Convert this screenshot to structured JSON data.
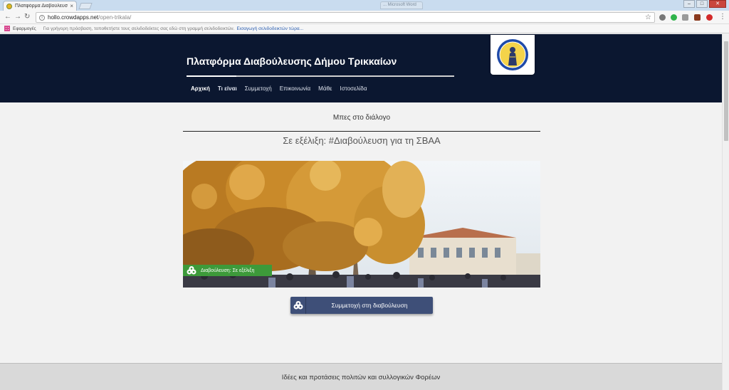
{
  "browser": {
    "tab_title": "Πλατφόρμα Διαβούλευσης",
    "tab_close": "×",
    "other_tab_title": "... Microsoft Word",
    "url_host": "hollo.crowdapps.net",
    "url_path": "/open-trikala/",
    "window_controls": {
      "minimize": "–",
      "maximize": "□",
      "close": "✕"
    }
  },
  "bookmarks": {
    "label": "Εφαρμογές",
    "hint": "Για γρήγορη πρόσβαση, τοποθετήστε τους σελιδοδείκτες σας εδώ στη γραμμή σελιδοδεικτών.",
    "link": "Εισαγωγή σελιδοδεικτών τώρα..."
  },
  "header": {
    "title": "Πλατφόρμα Διαβούλευσης Δήμου Τρικκαίων",
    "nav": [
      "Αρχική",
      "Τι είναι",
      "Συμμετοχή",
      "Επικοινωνία",
      "Μάθε",
      "Ιστοσελίδα"
    ],
    "active_nav": "Αρχική",
    "colors": {
      "header_bg": "#0b1730",
      "badge_green": "#3d9a3a",
      "button_bg": "#3e4f78"
    }
  },
  "main": {
    "dialog_heading": "Μπες στο διάλογο",
    "ongoing_title": "Σε εξέλιξη: #Διαβούλευση για τη ΣΒΑΑ",
    "status_badge": "Διαβούλευση: Σε εξέλιξη",
    "participate_button": "Συμμετοχή στη διαβούλευση"
  },
  "footer": {
    "text": "Ιδέες και προτάσεις πολιτών και συλλογικών Φορέων"
  }
}
